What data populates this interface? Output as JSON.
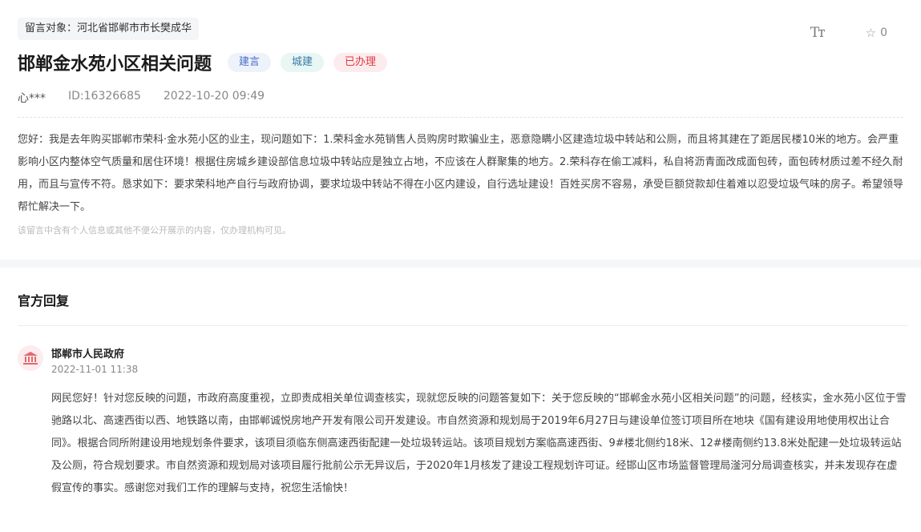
{
  "recipient": "留言对象：河北省邯郸市市长樊成华",
  "tools": {
    "font_icon_label": "Tт",
    "favorite_count": "0"
  },
  "title": "邯郸金水苑小区相关问题",
  "tags": [
    "建言",
    "城建",
    "已办理"
  ],
  "meta": {
    "author": "心***",
    "id": "ID:16326685",
    "datetime": "2022-10-20 09:49"
  },
  "content": "您好：我是去年购买邯郸市荣科·金水苑小区的业主，现问题如下：1.荣科金水苑销售人员购房时欺骗业主，恶意隐瞒小区建造垃圾中转站和公厕，而且将其建在了距居民楼10米的地方。会严重影响小区内整体空气质量和居住环境！根据住房城乡建设部信息垃圾中转站应是独立占地，不应该在人群聚集的地方。2.荣科存在偷工减料，私自将沥青面改成面包砖，面包砖材质过差不经久耐用，而且与宣传不符。恳求如下：要求荣科地产自行与政府协调，要求垃圾中转站不得在小区内建设，自行选址建设！百姓买房不容易，承受巨额贷款却住着难以忍受垃圾气味的房子。希望领导帮忙解决一下。",
  "privacy_note": "该留言中含有个人信息或其他不便公开展示的内容，仅办理机构可见。",
  "reply": {
    "section_title": "官方回复",
    "org": "邯郸市人民政府",
    "date": "2022-11-01 11:38",
    "text": "网民您好！针对您反映的问题，市政府高度重视，立即责成相关单位调查核实，现就您反映的问题答复如下：关于您反映的“邯郸金水苑小区相关问题”的问题，经核实，金水苑小区位于雪驰路以北、高速西街以西、地铁路以南，由邯郸诚悦房地产开发有限公司开发建设。市自然资源和规划局于2019年6月27日与建设单位签订项目所在地块《国有建设用地使用权出让合同》。根据合同所附建设用地规划条件要求，该项目须临东侧高速西街配建一处垃圾转运站。该项目规划方案临高速西街、9#楼北侧约18米、12#楼南侧约13.8米处配建一处垃圾转运站及公厕，符合规划要求。市自然资源和规划局对该项目履行批前公示无异议后，于2020年1月核发了建设工程规划许可证。经邯山区市场监督管理局滏河分局调查核实，并未发现存在虚假宣传的事实。感谢您对我们工作的理解与支持，祝您生活愉快！"
  },
  "colors": {
    "tag_red": "#e0393e",
    "tag_blue": "#4a6fc4",
    "gov_icon": "#e06a6e"
  }
}
